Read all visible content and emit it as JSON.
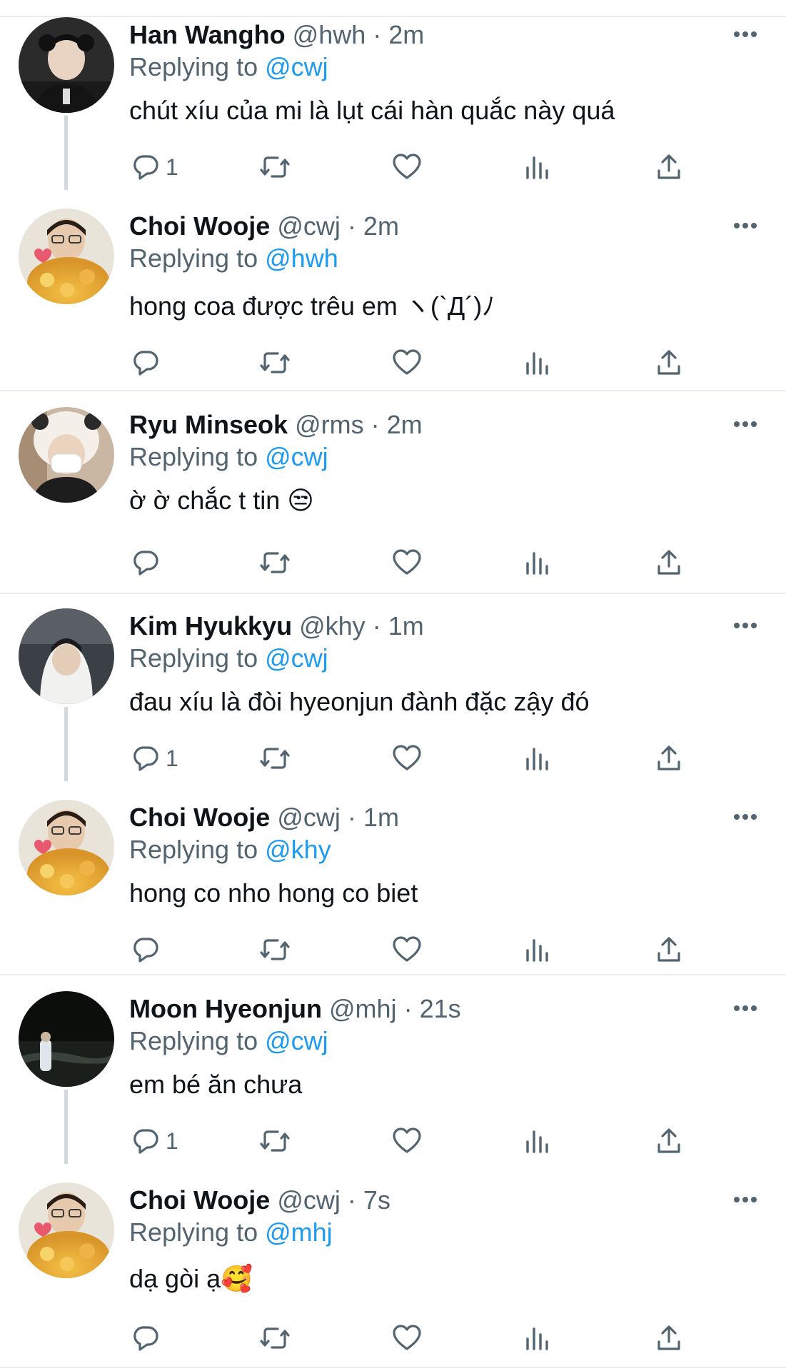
{
  "tweets": [
    {
      "name": "Han Wangho",
      "handle": "@hwh",
      "time": "2m",
      "replying_label": "Replying to",
      "reply_to": "@cwj",
      "text": "chút xíu của mi là lụt cái hàn quắc này quá",
      "replies": "1",
      "avatar": "avatar-hwh"
    },
    {
      "name": "Choi Wooje",
      "handle": "@cwj",
      "time": "2m",
      "replying_label": "Replying to",
      "reply_to": "@hwh",
      "text": "hong coa được trêu em ヽ(`Д´)ﾉ",
      "replies": "",
      "avatar": "avatar-cwj"
    },
    {
      "name": "Ryu Minseok",
      "handle": "@rms",
      "time": "2m",
      "replying_label": "Replying to",
      "reply_to": "@cwj",
      "text": "ờ ờ chắc t tin 😒",
      "replies": "",
      "avatar": "avatar-rms"
    },
    {
      "name": "Kim Hyukkyu",
      "handle": "@khy",
      "time": "1m",
      "replying_label": "Replying to",
      "reply_to": "@cwj",
      "text": "đau xíu là đòi hyeonjun đành đặc zậy đó",
      "replies": "1",
      "avatar": "avatar-khy"
    },
    {
      "name": "Choi Wooje",
      "handle": "@cwj",
      "time": "1m",
      "replying_label": "Replying to",
      "reply_to": "@khy",
      "text": "hong co nho hong co biet",
      "replies": "",
      "avatar": "avatar-cwj"
    },
    {
      "name": "Moon Hyeonjun",
      "handle": "@mhj",
      "time": "21s",
      "replying_label": "Replying to",
      "reply_to": "@cwj",
      "text": "em bé ăn chưa",
      "replies": "1",
      "avatar": "avatar-mhj"
    },
    {
      "name": "Choi Wooje",
      "handle": "@cwj",
      "time": "7s",
      "replying_label": "Replying to",
      "reply_to": "@mhj",
      "text": "dạ gòi ạ🥰",
      "replies": "",
      "avatar": "avatar-cwj"
    }
  ],
  "meta_separator": "·",
  "icons": {
    "reply": "reply-icon",
    "retweet": "retweet-icon",
    "like": "like-icon",
    "views": "views-icon",
    "share": "share-icon",
    "more": "more-icon"
  },
  "colors": {
    "mention": "#1d9bf0",
    "secondary_text": "#536471",
    "divider": "#e6ecf0"
  }
}
